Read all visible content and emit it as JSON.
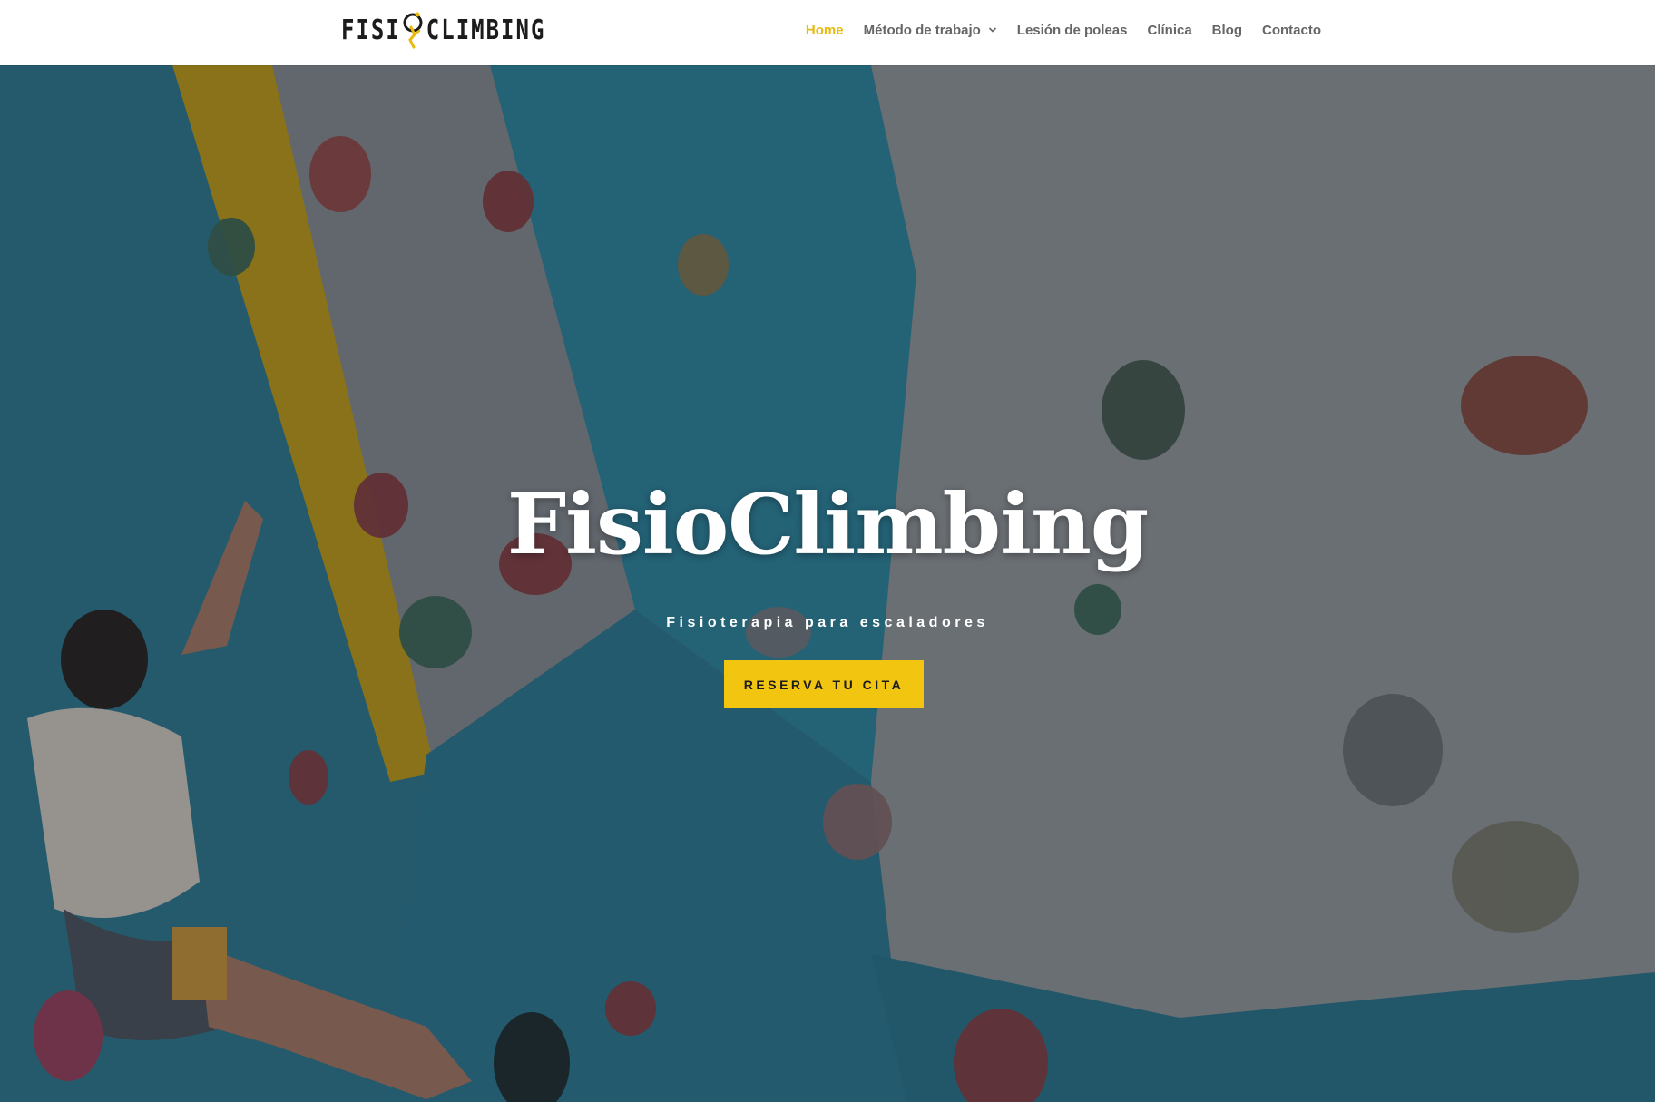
{
  "brand": {
    "logo_left": "FISI",
    "logo_right": "CLIMBING",
    "accent": "#e8b90e"
  },
  "nav": {
    "items": [
      {
        "label": "Home",
        "active": true
      },
      {
        "label": "Método de trabajo",
        "has_dropdown": true
      },
      {
        "label": "Lesión de poleas"
      },
      {
        "label": "Clínica"
      },
      {
        "label": "Blog"
      },
      {
        "label": "Contacto"
      }
    ]
  },
  "hero": {
    "title": "FisioClimbing",
    "subtitle": "Fisioterapia para escaladores",
    "cta_label": "RESERVA TU CITA",
    "cta_color": "#f2c511",
    "background": "climbing-wall-photo"
  }
}
